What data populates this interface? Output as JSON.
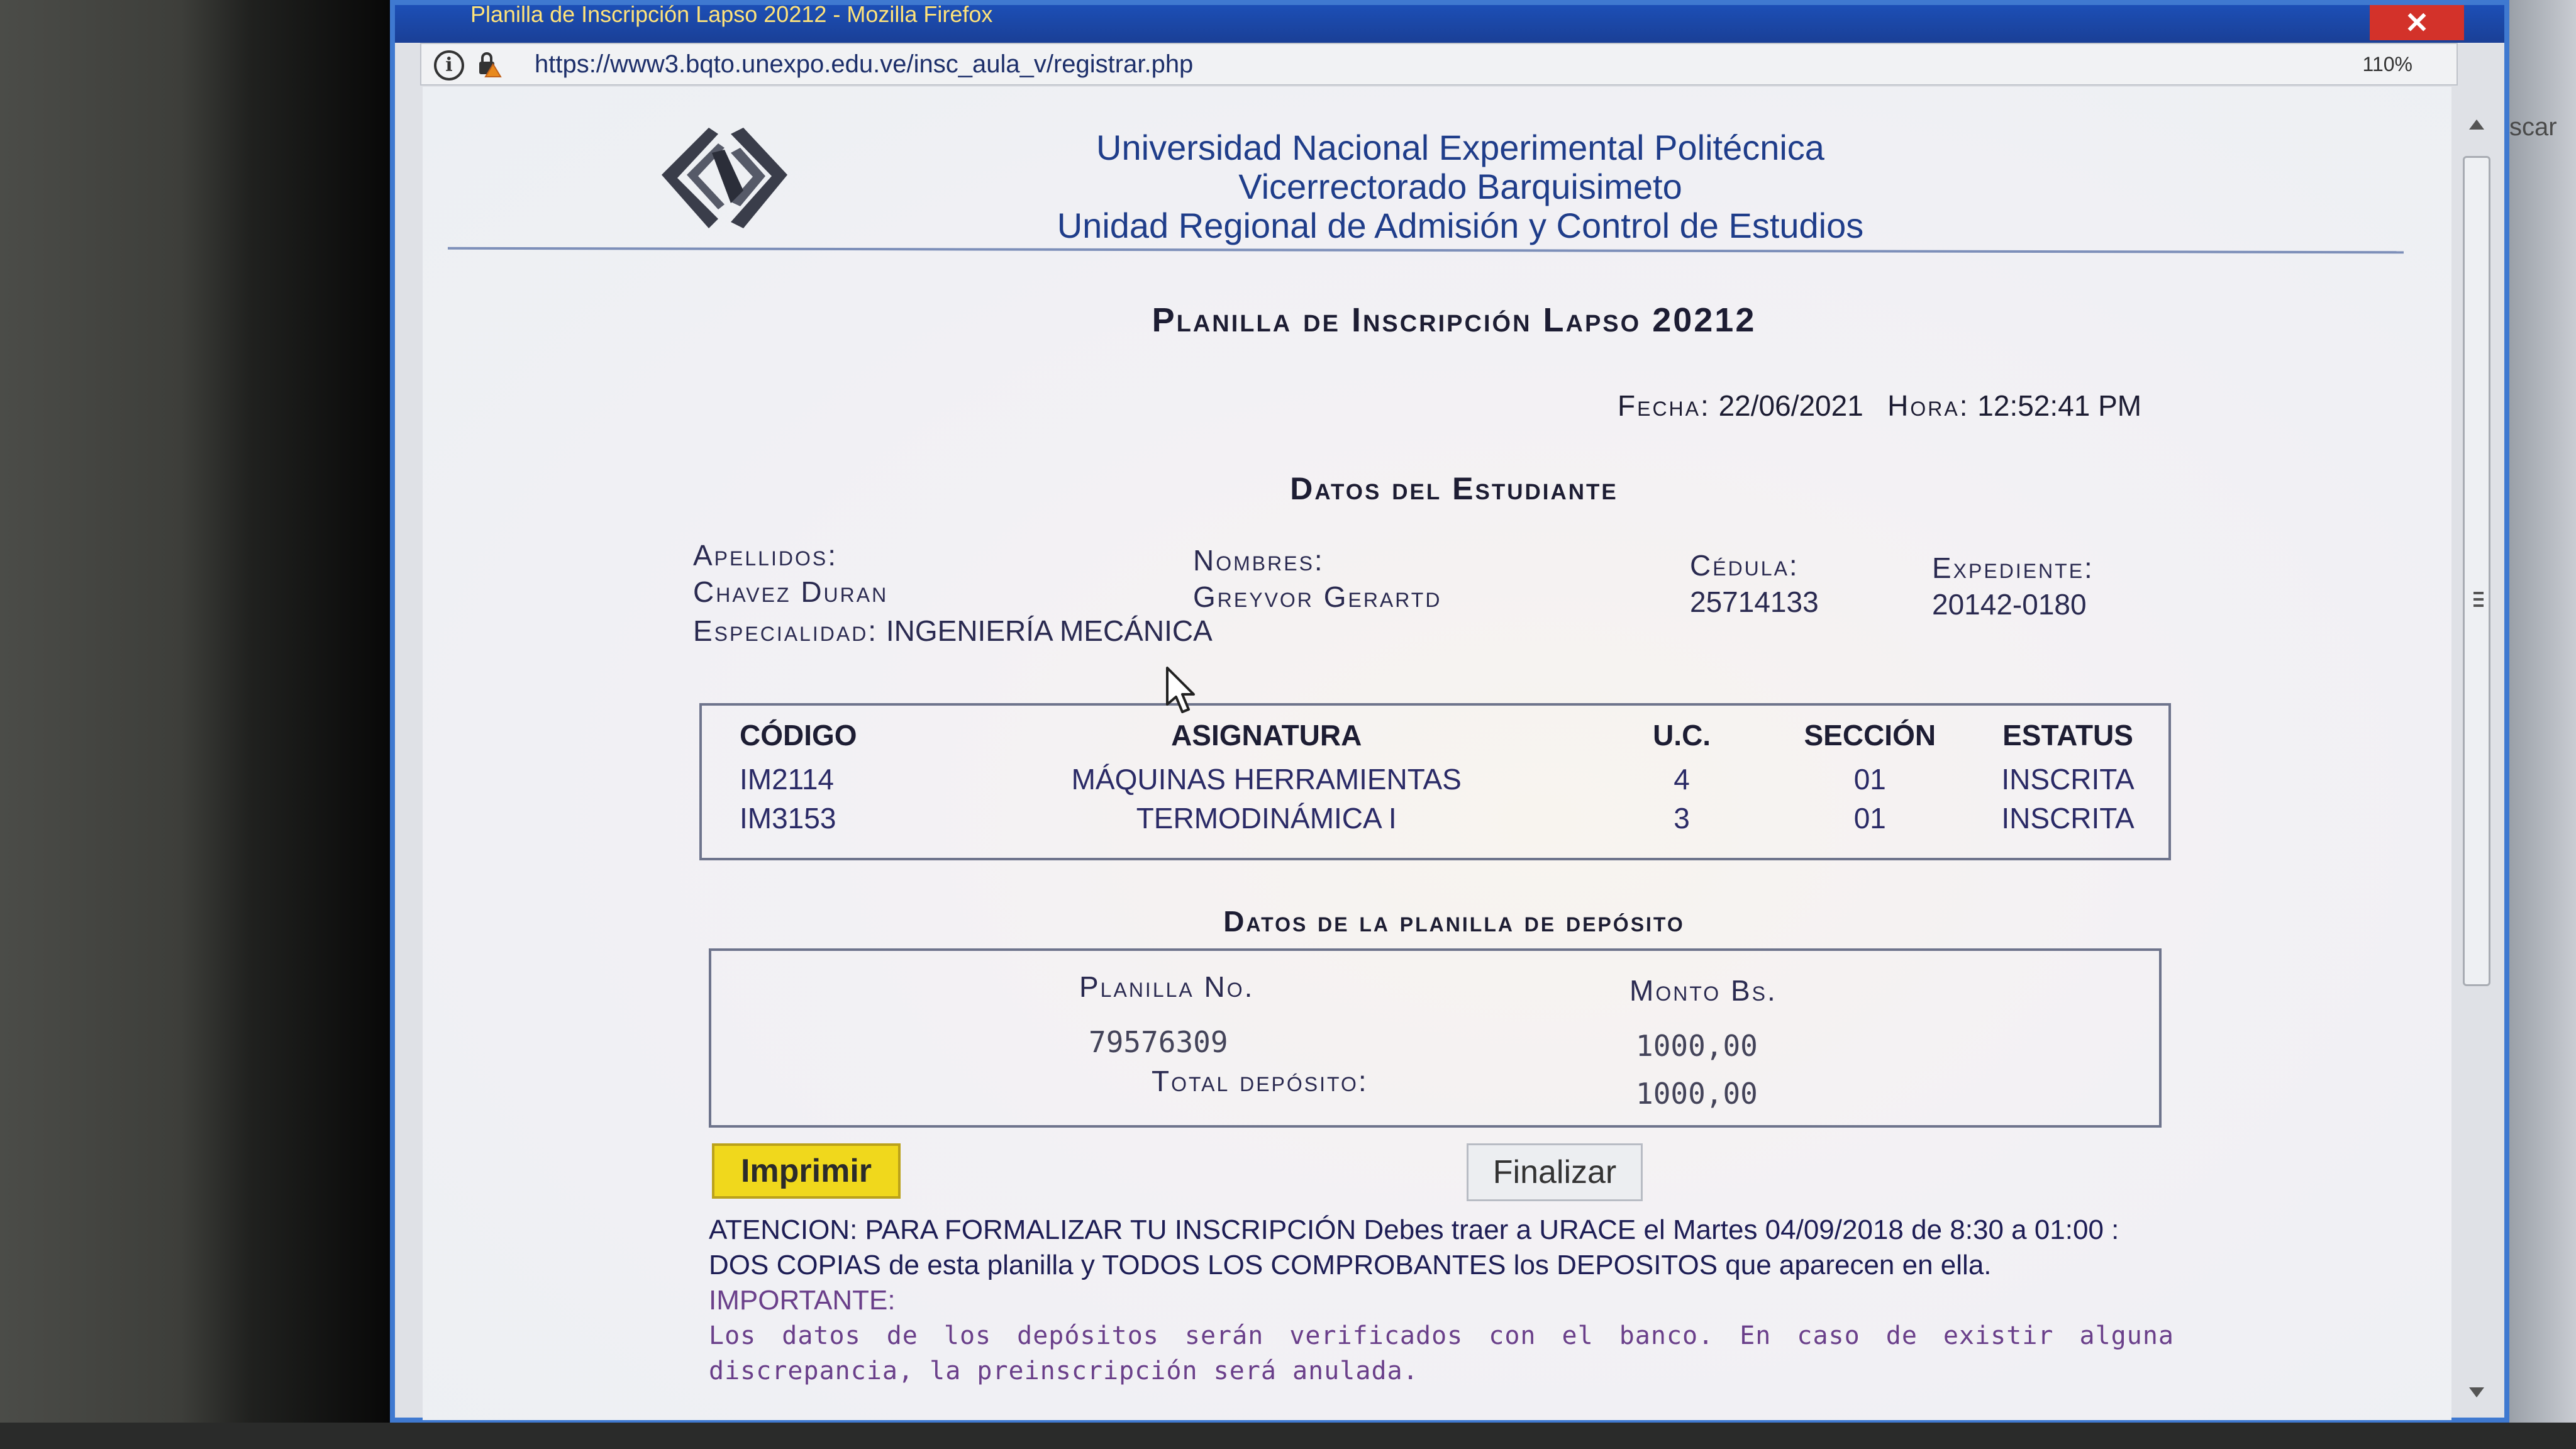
{
  "window": {
    "title": "Planilla de Inscripción Lapso 20212 - Mozilla Firefox",
    "url": "https://www3.bqto.unexpo.edu.ve/insc_aula_v/registrar.php",
    "zoom": "110%",
    "right_sliver": "scar"
  },
  "header": {
    "line1": "Universidad Nacional Experimental Politécnica",
    "line2": "Vicerrectorado Barquisimeto",
    "line3": "Unidad Regional de Admisión y Control de Estudios"
  },
  "form": {
    "title": "Planilla de Inscripción Lapso 20212",
    "fecha_label": "Fecha:",
    "fecha": "22/06/2021",
    "hora_label": "Hora:",
    "hora": "12:52:41 PM"
  },
  "student": {
    "section_title": "Datos del Estudiante",
    "apellidos_label": "Apellidos:",
    "apellidos": "Chavez Duran",
    "nombres_label": "Nombres:",
    "nombres": "Greyvor Gerartd",
    "cedula_label": "Cédula:",
    "cedula": "25714133",
    "expediente_label": "Expediente:",
    "expediente": "20142-0180",
    "especialidad_label": "Especialidad:",
    "especialidad": "INGENIERÍA MECÁNICA"
  },
  "courses": {
    "headers": [
      "CÓDIGO",
      "ASIGNATURA",
      "U.C.",
      "SECCIÓN",
      "ESTATUS"
    ],
    "rows": [
      [
        "IM2114",
        "MÁQUINAS HERRAMIENTAS",
        "4",
        "01",
        "INSCRITA"
      ],
      [
        "IM3153",
        "TERMODINÁMICA I",
        "3",
        "01",
        "INSCRITA"
      ]
    ]
  },
  "deposit": {
    "section_title": "Datos de la planilla de depósito",
    "planilla_label": "Planilla No.",
    "monto_label": "Monto Bs.",
    "planilla_no": "79576309",
    "monto": "1000,00",
    "total_label": "Total depósito:",
    "total": "1000,00"
  },
  "actions": {
    "imprimir": "Imprimir",
    "finalizar": "Finalizar"
  },
  "notice": {
    "line1": "ATENCION: PARA FORMALIZAR TU INSCRIPCIÓN Debes traer a URACE el  Martes 04/09/2018 de 8:30 a 01:00 : DOS COPIAS de esta planilla y TODOS LOS COMPROBANTES los DEPOSITOS que aparecen en ella.",
    "important_label": "IMPORTANTE:",
    "details": "Los datos de los depósitos serán verificados con el banco. En caso de existir alguna discrepancia, la preinscripción será anulada."
  },
  "colors": {
    "window_border": "#3f79d0",
    "titlebar": "#1c4fb6",
    "close_button": "#d3322a",
    "imprimir_button": "#f0d81c",
    "header_text": "#1f3d8a"
  },
  "icons": [
    "info-icon",
    "lock-warning-icon",
    "close-icon",
    "university-logo",
    "mouse-cursor-icon"
  ]
}
